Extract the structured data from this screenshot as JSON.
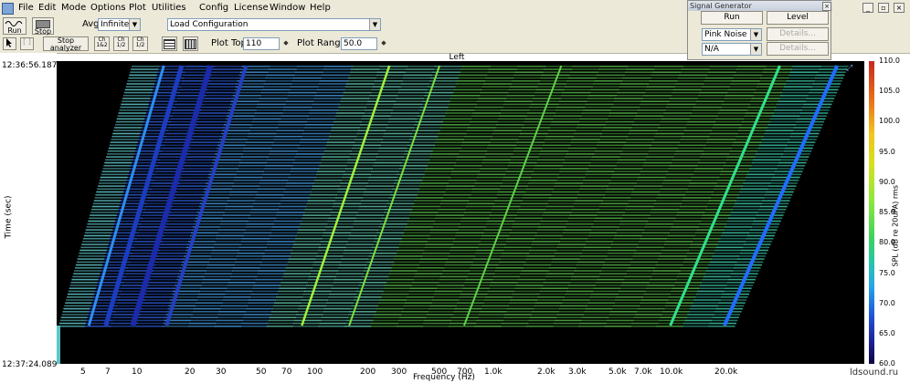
{
  "menu": [
    "File",
    "Edit",
    "Mode",
    "Options",
    "Plot",
    "Utilities",
    "Config",
    "License",
    "Window",
    "Help"
  ],
  "toolbar": {
    "run_label": "Run",
    "stop_label": "Stop",
    "avg_label": "Avg",
    "avg_value": "Infinite",
    "config_value": "Load Configuration",
    "stop_analyzer_label": "Stop analyzer",
    "view_buttons": [
      "Ch\n1&2",
      "Ch\n1/2",
      "Ch\n1/2"
    ],
    "plot_top_label": "Plot Top",
    "plot_top_value": "110",
    "plot_range_label": "Plot Range",
    "plot_range_value": "50.0"
  },
  "signal_generator": {
    "title": "Signal Generator",
    "run_label": "Run",
    "level_label": "Level",
    "noise_value": "Pink Noise",
    "na_value": "N/A",
    "details1": "Details...",
    "details2": "Details..."
  },
  "plot": {
    "channel_label": "Left",
    "time_top": "12:36:56.187",
    "time_bottom": "12:37:24.089",
    "y_label": "Time (sec)",
    "x_label": "Frequency (Hz)",
    "colorbar_label": "SPL (dB re 20uPA) rms",
    "freq_ticks": [
      "5",
      "7",
      "10",
      "20",
      "30",
      "50",
      "70",
      "100",
      "200",
      "300",
      "500",
      "700",
      "1.0k",
      "2.0k",
      "3.0k",
      "5.0k",
      "7.0k",
      "10.0k",
      "20.0k"
    ],
    "spl_ticks": [
      "110.0",
      "105.0",
      "100.0",
      "95.0",
      "90.0",
      "85.0",
      "80.0",
      "75.0",
      "70.0",
      "65.0",
      "60.0"
    ],
    "watermark": "ldsound.ru"
  },
  "colors": {
    "band_green": "#4cae3c",
    "band_teal": "#46b4a8",
    "band_blue": "#2447c8",
    "ridge_bright": "#9df23a"
  }
}
